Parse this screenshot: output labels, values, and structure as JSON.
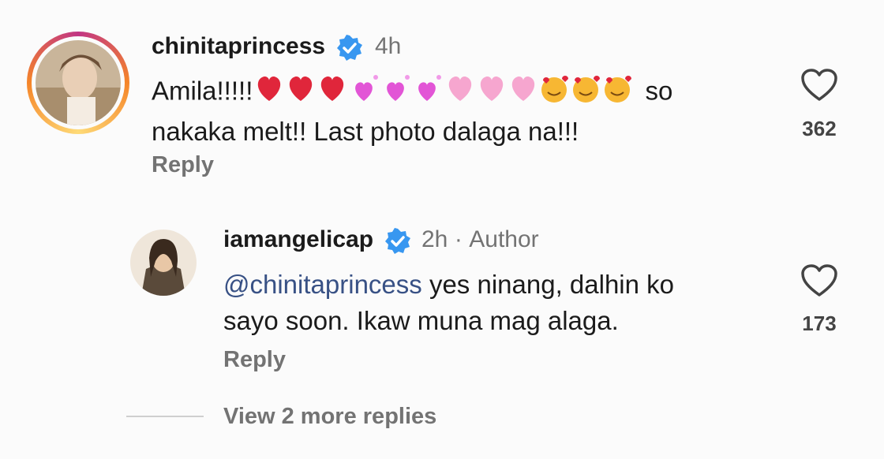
{
  "comments": [
    {
      "username": "chinitaprincess",
      "time": "4h",
      "text_line1_start": "Amila!!!!!",
      "text_line1_end": "so",
      "text_line2": "nakaka melt!! Last photo dalaga na!!!",
      "emojis": [
        "red-heart",
        "red-heart",
        "red-heart",
        "sparkling-heart",
        "sparkling-heart",
        "sparkling-heart",
        "pink-heart",
        "pink-heart",
        "pink-heart",
        "smiling-face-with-hearts",
        "smiling-face-with-hearts",
        "smiling-face-with-hearts"
      ],
      "reply_label": "Reply",
      "like_count": "362"
    },
    {
      "username": "iamangelicap",
      "time": "2h",
      "separator": "·",
      "author_label": "Author",
      "mention": "@chinitaprincess",
      "text_line1": " yes ninang, dalhin ko",
      "text_line2": "sayo soon. Ikaw muna mag alaga.",
      "reply_label": "Reply",
      "like_count": "173"
    }
  ],
  "view_more_label": "View 2 more replies",
  "colors": {
    "verified_blue": "#3897f0",
    "muted_text": "#737373",
    "mention_blue": "#385185",
    "red_heart": "#e0263b",
    "pink_heart": "#f6a6cf"
  }
}
